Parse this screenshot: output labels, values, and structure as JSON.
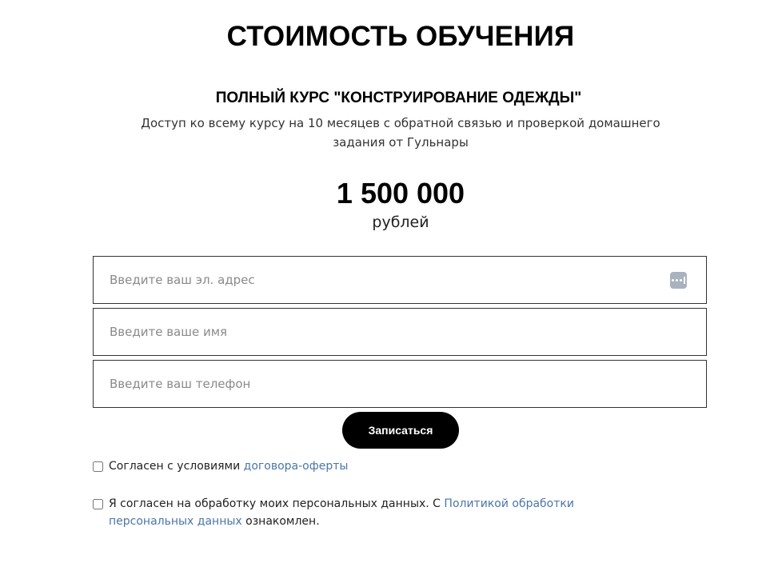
{
  "heading": "СТОИМОСТЬ ОБУЧЕНИЯ",
  "course": {
    "title": "ПОЛНЫЙ КУРС \"КОНСТРУИРОВАНИЕ ОДЕЖДЫ\"",
    "description": "Доступ ко всему курсу на 10 месяцев с обратной связью и проверкой домашнего задания от Гульнары"
  },
  "price": {
    "amount": "1 500 000",
    "currency": "рублей"
  },
  "form": {
    "email_placeholder": "Введите ваш эл. адрес",
    "email_value": "",
    "name_placeholder": "Введите ваше имя",
    "name_value": "",
    "phone_placeholder": "Введите ваш телефон",
    "phone_value": "",
    "autofill_icon": "password-manager-icon",
    "submit_label": "Записаться"
  },
  "consents": {
    "offer": {
      "text": "Согласен с условиями ",
      "link": "договора-оферты",
      "checked": false
    },
    "personal": {
      "text_before": "Я согласен на обработку моих персональных данных. С ",
      "link": "Политикой обработки персональных данных",
      "text_after": " ознакомлен.",
      "checked": false
    }
  },
  "colors": {
    "link": "#4a76a8",
    "button_bg": "#000000",
    "button_text": "#ffffff",
    "border": "#333333"
  }
}
